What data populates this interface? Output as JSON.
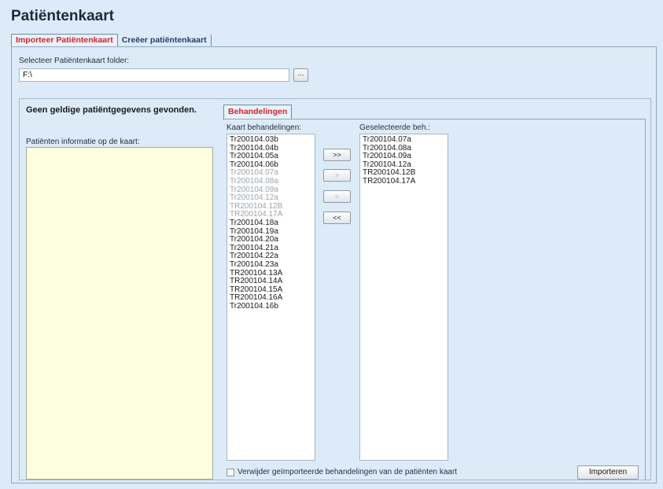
{
  "page_title": "Patiëntenkaart",
  "tabs": [
    {
      "label": "Importeer Patiëntenkaart",
      "active": true
    },
    {
      "label": "Creëer patiëntenkaart",
      "active": false
    }
  ],
  "folder": {
    "label": "Selecteer Patiëntenkaart folder:",
    "value": "F:\\",
    "browse_label": "..."
  },
  "no_data_message": "Geen geldige patiëntgegevens gevonden.",
  "patient_info_label": "Patiënten informatie op de kaart:",
  "sub_tab": {
    "label": "Behandelingen"
  },
  "card_treatments": {
    "label": "Kaart behandelingen:",
    "items": [
      {
        "text": "Tr200104.03b",
        "dim": false
      },
      {
        "text": "Tr200104.04b",
        "dim": false
      },
      {
        "text": "Tr200104.05a",
        "dim": false
      },
      {
        "text": "Tr200104.06b",
        "dim": false
      },
      {
        "text": "Tr200104.07a",
        "dim": true
      },
      {
        "text": "Tr200104.08a",
        "dim": true
      },
      {
        "text": "Tr200104.09a",
        "dim": true
      },
      {
        "text": "Tr200104.12a",
        "dim": true
      },
      {
        "text": "TR200104.12B",
        "dim": true
      },
      {
        "text": "TR200104.17A",
        "dim": true
      },
      {
        "text": "Tr200104.18a",
        "dim": false
      },
      {
        "text": "Tr200104.19a",
        "dim": false
      },
      {
        "text": "Tr200104.20a",
        "dim": false
      },
      {
        "text": "Tr200104.21a",
        "dim": false
      },
      {
        "text": "Tr200104.22a",
        "dim": false
      },
      {
        "text": "Tr200104.23a",
        "dim": false
      },
      {
        "text": "TR200104.13A",
        "dim": false
      },
      {
        "text": "TR200104.14A",
        "dim": false
      },
      {
        "text": "TR200104.15A",
        "dim": false
      },
      {
        "text": "TR200104.16A",
        "dim": false
      },
      {
        "text": "Tr200104.16b",
        "dim": false
      }
    ]
  },
  "selected_treatments": {
    "label": "Geselecteerde beh.:",
    "items": [
      {
        "text": "Tr200104.07a"
      },
      {
        "text": "Tr200104.08a"
      },
      {
        "text": "Tr200104.09a"
      },
      {
        "text": "Tr200104.12a"
      },
      {
        "text": "TR200104.12B"
      },
      {
        "text": "TR200104.17A"
      }
    ]
  },
  "move_buttons": {
    "add_all": {
      "label": ">>",
      "enabled": true
    },
    "add": {
      "label": ">",
      "enabled": false
    },
    "remove": {
      "label": "<",
      "enabled": false
    },
    "remove_all": {
      "label": "<<",
      "enabled": true
    }
  },
  "delete_checkbox": {
    "label": "Verwijder geïmporteerde behandelingen van de patiënten kaart",
    "checked": false
  },
  "import_button": {
    "label": "Importeren"
  },
  "colors": {
    "background": "#dcebf7",
    "active_tab_text": "#d4252a",
    "inactive_tab_text": "#233f6f",
    "info_box": "#fefee0"
  }
}
